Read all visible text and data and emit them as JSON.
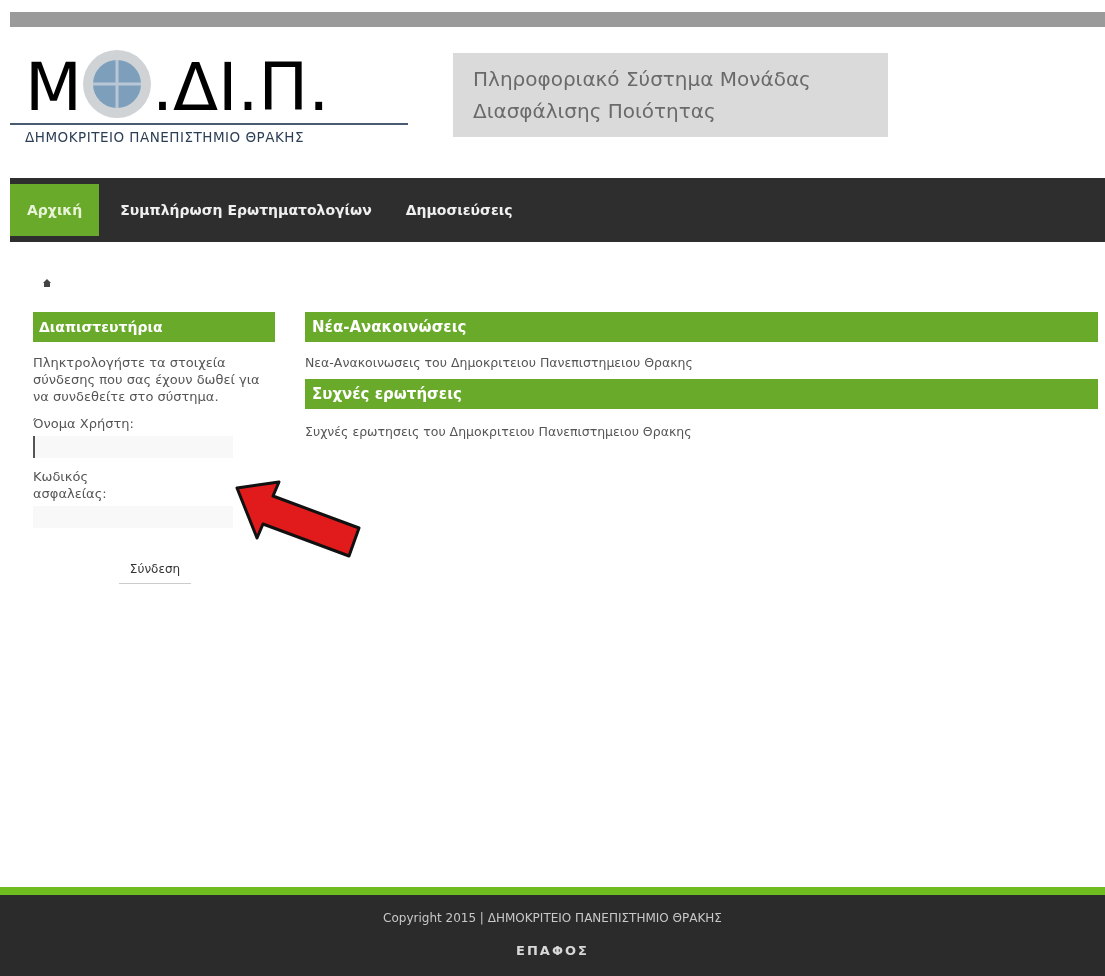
{
  "logo": {
    "letter": "Μ",
    "rest": ".ΔΙ.Π.",
    "subtitle": "ΔΗΜΟΚΡΙΤΕΙΟ ΠΑΝΕΠΙΣΤΗΜΙΟ ΘΡΑΚΗΣ"
  },
  "site_title": [
    "Πληροφοριακό Σύστημα Μονάδας",
    "Διασφάλισης Ποιότητας"
  ],
  "nav": [
    {
      "label": "Αρχική",
      "selected": true
    },
    {
      "label": "Συμπλήρωση Ερωτηματολογίων",
      "selected": false
    },
    {
      "label": "Δημοσιεύσεις",
      "selected": false
    }
  ],
  "login": {
    "title": "Διαπιστευτήρια",
    "intro": "Πληκτρολογήστε τα στοιχεία σύνδεσης που σας έχουν δωθεί για να συνδεθείτε στο σύστημα.",
    "fields": [
      {
        "label": "Όνομα Χρήστη:",
        "focused": true
      },
      {
        "label": "Κωδικός ασφαλείας:",
        "focused": false
      }
    ],
    "button": "Σύνδεση"
  },
  "sections": [
    {
      "title": "Νέα-Ανακοινώσεις",
      "text": "Νεα-Ανακοινωσεις του Δημοκριτειου Πανεπιστημειου Θρακης"
    },
    {
      "title": "Συχνές ερωτήσεις",
      "text": "Συχνές ερωτησεις του Δημοκριτειου Πανεπιστημειου Θρακης"
    }
  ],
  "footer": {
    "copyright": "Copyright 2015 | ΔΗΜΟΚΡΙΤΕΙΟ ΠΑΝΕΠΙΣΤΗΜΙΟ ΘΡΑΚΗΣ",
    "contact": "ΕΠΑΦΟΣ"
  }
}
